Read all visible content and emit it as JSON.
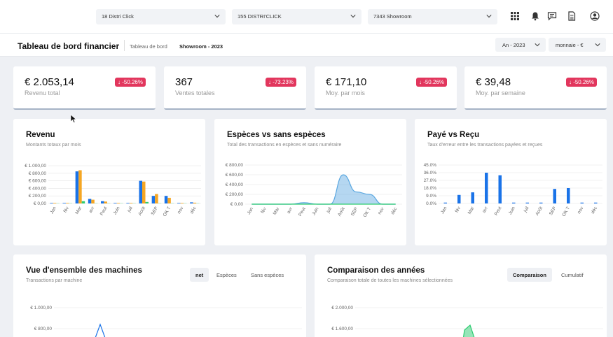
{
  "topbar": {
    "select1": "18 Distri Click",
    "select2": "155 DISTRI'CLICK",
    "select3": "7343 Showroom",
    "icons": [
      "grid-icon",
      "bell-icon",
      "chat-icon",
      "document-icon",
      "user-icon"
    ]
  },
  "header": {
    "title": "Tableau de bord financier",
    "breadcrumb1": "Tableau de bord",
    "breadcrumb2": "Showroom - 2023",
    "year_select": "An - 2023",
    "currency_select": "monnaie - €"
  },
  "kpis": [
    {
      "value": "€ 2.053,14",
      "label": "Revenu total",
      "badge": "↓ -50.26%"
    },
    {
      "value": "367",
      "label": "Ventes totales",
      "badge": "↓ -73.23%"
    },
    {
      "value": "€ 171,10",
      "label": "Moy. par mois",
      "badge": "↓ -50.26%"
    },
    {
      "value": "€ 39,48",
      "label": "Moy. par semaine",
      "badge": "↓ -50.26%"
    }
  ],
  "cards": {
    "revenu": {
      "title": "Revenu",
      "subtitle": "Montants totaux par mois"
    },
    "especes": {
      "title": "Espèces vs sans espèces",
      "subtitle": "Total des transactions en espèces et sans numéraire"
    },
    "paye": {
      "title": "Payé vs Reçu",
      "subtitle": "Taux d'erreur entre les transactions payées et reçues"
    },
    "machines": {
      "title": "Vue d'ensemble des machines",
      "subtitle": "Transactions par machine",
      "tabs": [
        "net",
        "Espèces",
        "Sans espèces"
      ]
    },
    "annees": {
      "title": "Comparaison des années",
      "subtitle": "Comparaison totale de toutes les machines sélectionnées",
      "tabs": [
        "Comparaison",
        "Cumulatif"
      ]
    }
  },
  "colors": {
    "blue": "#1a73e8",
    "orange": "#f5a623",
    "green": "#2ecc71",
    "badge": "#e2365d",
    "area": "#5aa7e0"
  },
  "chart_data": [
    {
      "type": "bar",
      "title": "Revenu",
      "ylim": [
        0,
        1000
      ],
      "yticks": [
        "€ 0,00",
        "€ 200,00",
        "€ 400,00",
        "€ 600,00",
        "€ 800,00",
        "€ 1.000,00"
      ],
      "categories": [
        "Jan",
        "f&#233;v",
        "Mar",
        "avr",
        "Peut",
        "Juin",
        "juil",
        "Ao&#251;t",
        "SEP",
        "OK T",
        "nov",
        "d&#233;c"
      ],
      "series": [
        {
          "color": "#1a73e8",
          "values": [
            15,
            15,
            850,
            120,
            60,
            15,
            15,
            600,
            200,
            200,
            15,
            30
          ]
        },
        {
          "color": "#f5a623",
          "values": [
            15,
            15,
            880,
            100,
            50,
            15,
            15,
            580,
            250,
            150,
            15,
            20
          ]
        },
        {
          "color": "#2ecc71",
          "values": [
            5,
            5,
            60,
            5,
            5,
            5,
            5,
            40,
            5,
            5,
            5,
            5
          ]
        }
      ]
    },
    {
      "type": "area",
      "title": "Espèces vs sans espèces",
      "ylim": [
        0,
        800
      ],
      "yticks": [
        "€ 0,00",
        "€ 200,00",
        "€ 400,00",
        "€ 600,00",
        "€ 800,00"
      ],
      "categories": [
        "Jan",
        "f&#233;v",
        "Mar",
        "avr",
        "Peut",
        "Juin",
        "juil",
        "Ao&#251;t",
        "SEP",
        "OK T",
        "nov",
        "d&#233;c"
      ],
      "series": [
        {
          "color": "#5aa7e0",
          "values": [
            0,
            0,
            0,
            0,
            30,
            0,
            0,
            600,
            250,
            200,
            0,
            0
          ]
        },
        {
          "color": "#2ecc71",
          "values": [
            0,
            0,
            0,
            0,
            0,
            0,
            0,
            0,
            0,
            0,
            0,
            0
          ]
        }
      ]
    },
    {
      "type": "bar",
      "title": "Payé vs Reçu",
      "ylim": [
        0,
        45
      ],
      "yticks": [
        "0.0%",
        "9.0%",
        "18.0%",
        "27.0%",
        "36.0%",
        "45.0%"
      ],
      "categories": [
        "Jan",
        "f&#233;v",
        "Mar",
        "avr",
        "Peut",
        "Juin",
        "juil",
        "Ao&#251;t",
        "SEP",
        "OK T",
        "nov",
        "d&#233;c"
      ],
      "series": [
        {
          "color": "#1a73e8",
          "values": [
            1,
            10,
            13,
            36,
            33,
            1,
            1,
            1,
            17,
            18,
            1,
            1
          ]
        }
      ]
    },
    {
      "type": "line",
      "title": "Vue d'ensemble des machines",
      "yticks": [
        "€ 1.000,00",
        "€ 800,00"
      ]
    },
    {
      "type": "line",
      "title": "Comparaison des années",
      "yticks": [
        "€ 2.000,00",
        "€ 1.600,00"
      ]
    }
  ]
}
